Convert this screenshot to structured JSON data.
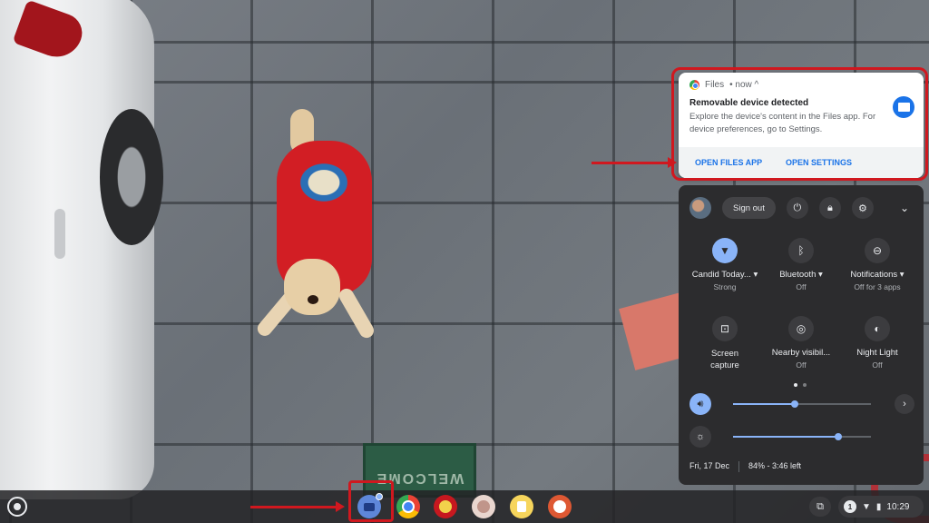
{
  "notification": {
    "app_name": "Files",
    "time": "• now ^",
    "title": "Removable device detected",
    "body": "Explore the device's content in the Files app. For device preferences, go to Settings.",
    "actions": [
      "OPEN FILES APP",
      "OPEN SETTINGS"
    ]
  },
  "quick_settings": {
    "sign_out_label": "Sign out",
    "header_icons": [
      "power-icon",
      "lock-icon",
      "gear-icon",
      "chevron-down-icon"
    ],
    "tiles": [
      {
        "label": "Candid Today...",
        "sub": "Strong",
        "icon": "wifi-icon",
        "active": true
      },
      {
        "label": "Bluetooth",
        "sub": "Off",
        "icon": "bluetooth-icon",
        "active": false
      },
      {
        "label": "Notifications",
        "sub": "Off for 3 apps",
        "icon": "notifications-icon",
        "active": false
      },
      {
        "label": "Screen capture",
        "sub": "",
        "icon": "screen-capture-icon",
        "active": false
      },
      {
        "label": "Nearby visibil...",
        "sub": "Off",
        "icon": "nearby-share-icon",
        "active": false
      },
      {
        "label": "Night Light",
        "sub": "Off",
        "icon": "night-light-icon",
        "active": false
      }
    ],
    "volume_level": 0.45,
    "brightness_level": 0.76,
    "date": "Fri, 17 Dec",
    "battery": "84% - 3:46 left"
  },
  "shelf": {
    "apps": [
      "files-app-icon",
      "chrome-app-icon",
      "manchester-united-app-icon",
      "profile-app-icon",
      "keep-app-icon",
      "duckduckgo-app-icon"
    ],
    "notification_count": "1",
    "time": "10:29"
  },
  "wallpaper": {
    "mat_text": "WELCOME"
  },
  "colors": {
    "accent": "#8ab4f8",
    "highlight": "#d0181f",
    "panel": "#2c2c2e",
    "link": "#1a73e8"
  }
}
